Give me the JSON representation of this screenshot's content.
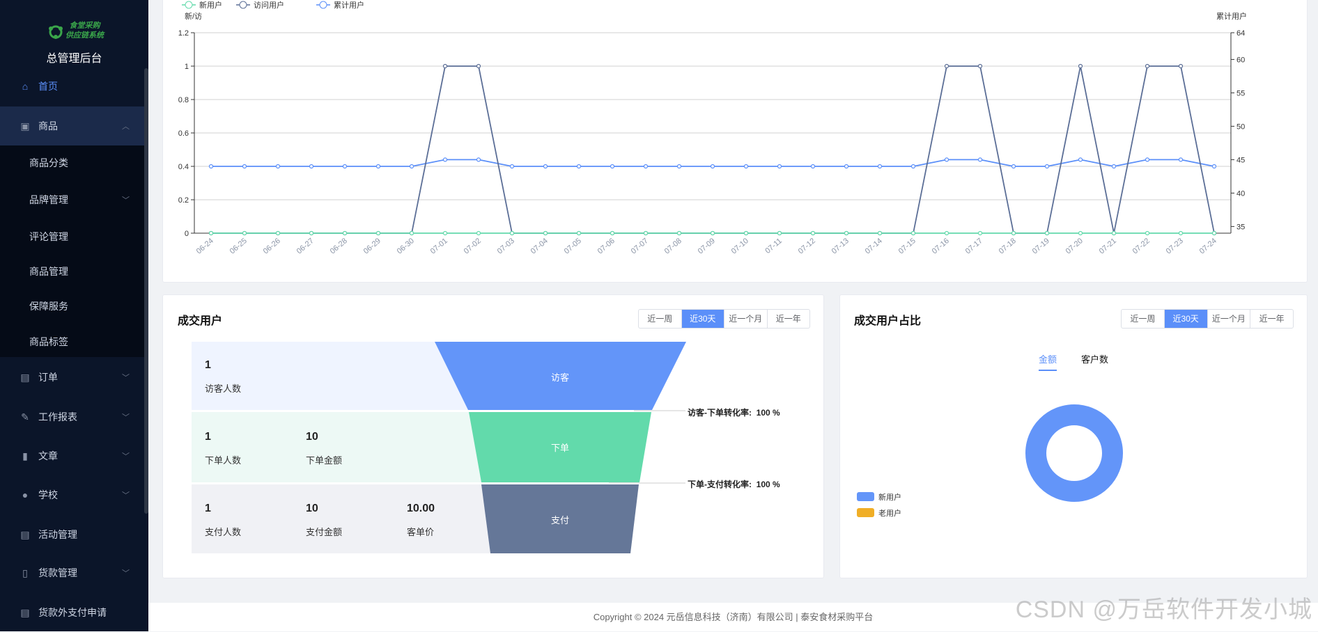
{
  "sidebar": {
    "logo_line1": "食堂采购",
    "logo_line2": "供应链系统",
    "title": "总管理后台",
    "items": [
      {
        "label": "首页",
        "icon": "home-icon"
      },
      {
        "label": "商品",
        "icon": "bag-icon"
      },
      {
        "label": "订单",
        "icon": "clipboard-icon"
      },
      {
        "label": "工作报表",
        "icon": "edit-icon"
      },
      {
        "label": "文章",
        "icon": "book-icon"
      },
      {
        "label": "学校",
        "icon": "user-icon"
      },
      {
        "label": "活动管理",
        "icon": "clipboard-icon"
      },
      {
        "label": "货款管理",
        "icon": "document-icon"
      },
      {
        "label": "货款外支付申请",
        "icon": "clipboard-icon"
      }
    ],
    "sub_items": [
      "商品分类",
      "品牌管理",
      "评论管理",
      "商品管理",
      "保障服务",
      "商品标签"
    ]
  },
  "colors": {
    "accent": "#5b8ff9",
    "new": "#62daab",
    "visit": "#5b6e96",
    "total": "#5b8ff9",
    "old": "#f0ae26"
  },
  "chart_data": {
    "type": "line",
    "legend": [
      "新用户",
      "访问用户",
      "累计用户"
    ],
    "left_axis_name": "新/访",
    "right_axis_name": "累计用户",
    "left_ylim": [
      0,
      1.2
    ],
    "left_ticks": [
      "0",
      "0.2",
      "0.4",
      "0.6",
      "0.8",
      "1",
      "1.2"
    ],
    "right_ylim": [
      34,
      64
    ],
    "right_ticks": [
      "35",
      "40",
      "45",
      "50",
      "55",
      "60",
      "64"
    ],
    "x": [
      "06-24",
      "06-25",
      "06-26",
      "06-27",
      "06-28",
      "06-29",
      "06-30",
      "07-01",
      "07-02",
      "07-03",
      "07-04",
      "07-05",
      "07-06",
      "07-07",
      "07-08",
      "07-09",
      "07-10",
      "07-11",
      "07-12",
      "07-13",
      "07-14",
      "07-15",
      "07-16",
      "07-17",
      "07-18",
      "07-19",
      "07-20",
      "07-21",
      "07-22",
      "07-23",
      "07-24"
    ],
    "series": [
      {
        "name": "新用户",
        "axis": "left",
        "values": [
          0,
          0,
          0,
          0,
          0,
          0,
          0,
          0,
          0,
          0,
          0,
          0,
          0,
          0,
          0,
          0,
          0,
          0,
          0,
          0,
          0,
          0,
          0,
          0,
          0,
          0,
          0,
          0,
          0,
          0,
          0
        ]
      },
      {
        "name": "访问用户",
        "axis": "left",
        "values": [
          0,
          0,
          0,
          0,
          0,
          0,
          0,
          1,
          1,
          0,
          0,
          0,
          0,
          0,
          0,
          0,
          0,
          0,
          0,
          0,
          0,
          0,
          1,
          1,
          0,
          0,
          1,
          0,
          1,
          1,
          0
        ]
      },
      {
        "name": "累计用户",
        "axis": "right",
        "values": [
          44,
          44,
          44,
          44,
          44,
          44,
          44,
          45,
          45,
          44,
          44,
          44,
          44,
          44,
          44,
          44,
          44,
          44,
          44,
          44,
          44,
          44,
          45,
          45,
          44,
          44,
          45,
          44,
          45,
          45,
          44
        ]
      }
    ]
  },
  "deal": {
    "title": "成交用户",
    "ranges": [
      "近一周",
      "近30天",
      "近一个月",
      "近一年"
    ],
    "rows": [
      {
        "stage": "访客",
        "stats": [
          {
            "value": "1",
            "label": "访客人数"
          }
        ]
      },
      {
        "stage": "下单",
        "stats": [
          {
            "value": "1",
            "label": "下单人数"
          },
          {
            "value": "10",
            "label": "下单金额"
          }
        ]
      },
      {
        "stage": "支付",
        "stats": [
          {
            "value": "1",
            "label": "支付人数"
          },
          {
            "value": "10",
            "label": "支付金额"
          },
          {
            "value": "10.00",
            "label": "客单价"
          }
        ]
      }
    ],
    "conv1": "访客-下单转化率:  100 %",
    "conv2": "下单-支付转化率:  100 %"
  },
  "ratio": {
    "title": "成交用户占比",
    "ranges": [
      "近一周",
      "近30天",
      "近一个月",
      "近一年"
    ],
    "tabs": [
      "金额",
      "客户数"
    ],
    "legend": [
      "新用户",
      "老用户"
    ],
    "values": {
      "新用户": 1,
      "老用户": 0
    }
  },
  "footer": "Copyright © 2024 元岳信息科技（济南）有限公司 | 泰安食材采购平台",
  "watermark": "CSDN @万岳软件开发小城"
}
